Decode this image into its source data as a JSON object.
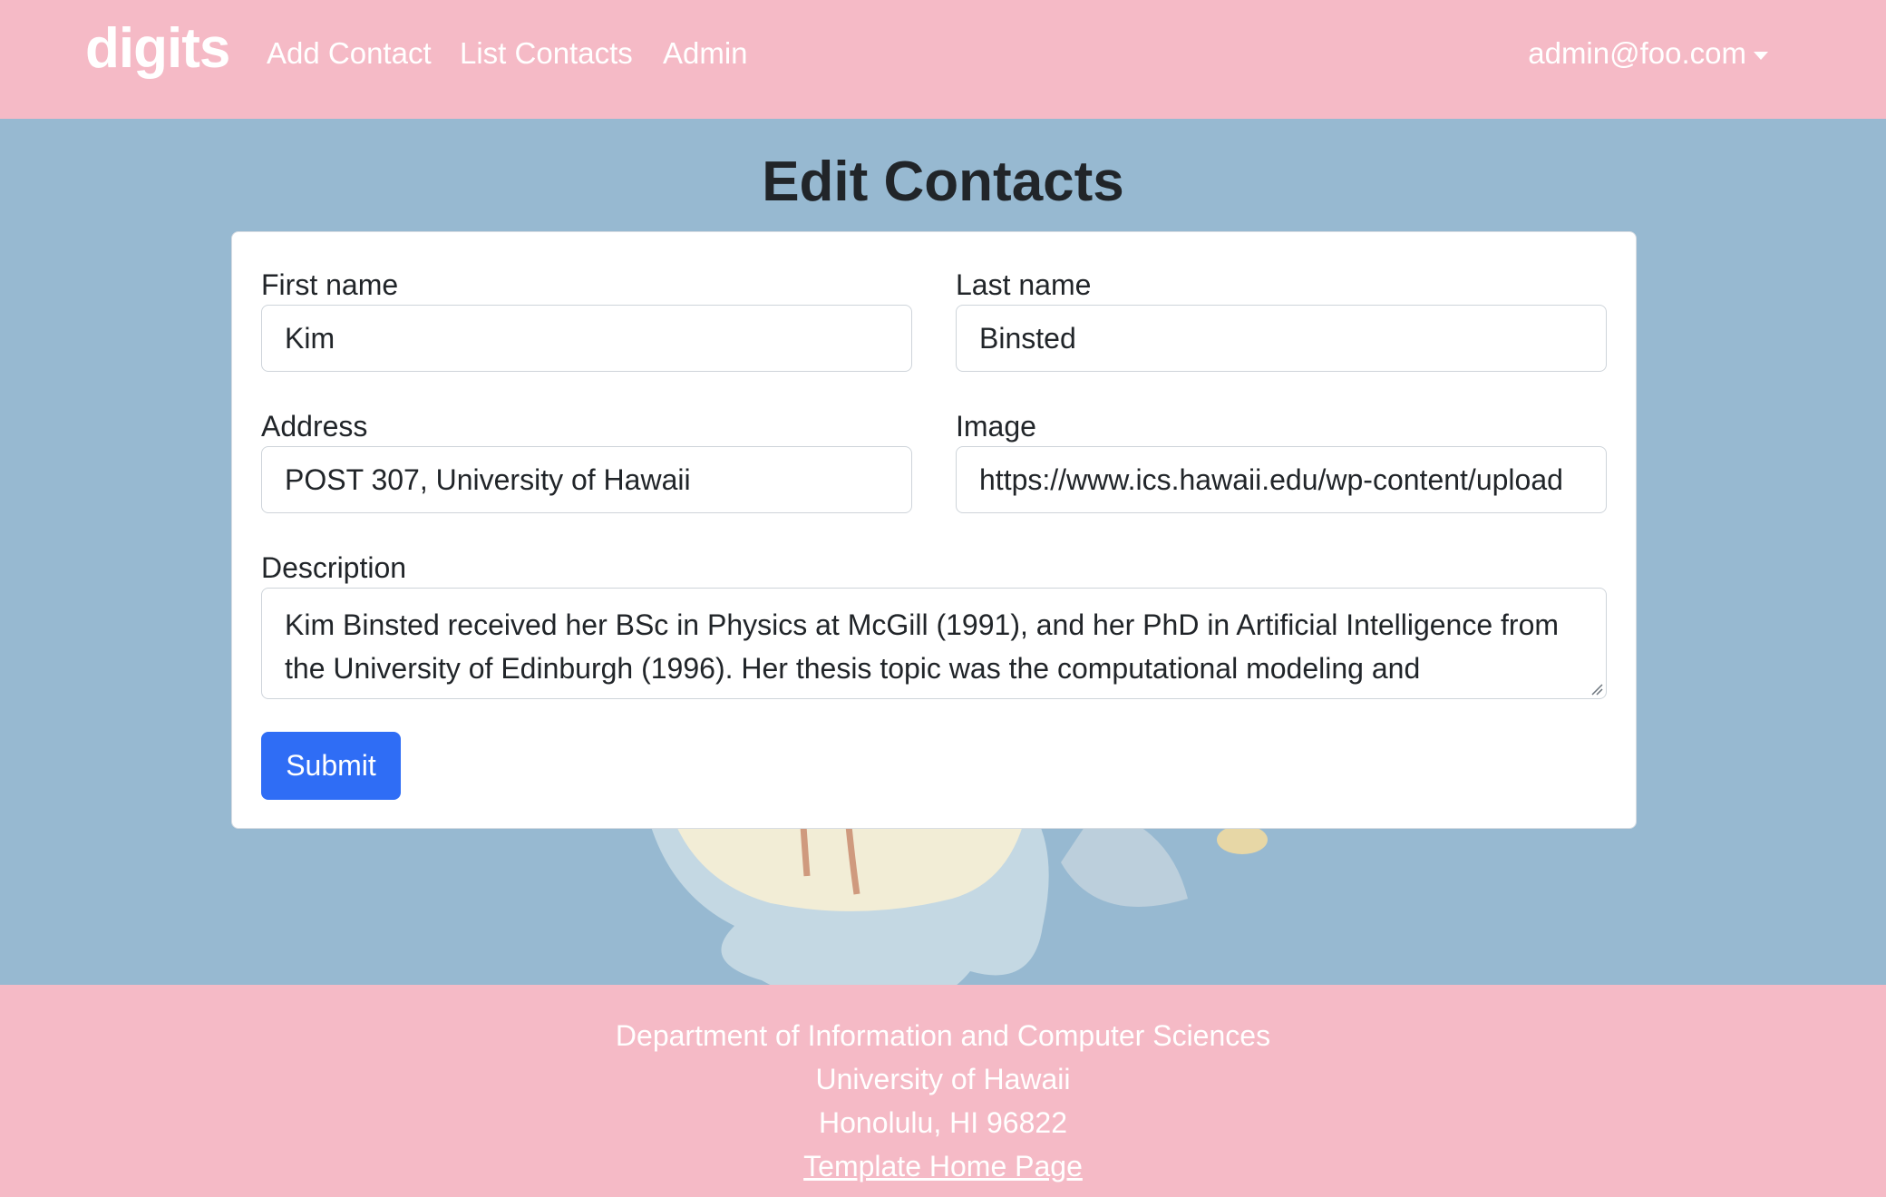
{
  "navbar": {
    "brand": "digits",
    "links": [
      "Add Contact",
      "List Contacts",
      "Admin"
    ],
    "user": "admin@foo.com"
  },
  "page": {
    "title": "Edit Contacts"
  },
  "form": {
    "first_name": {
      "label": "First name",
      "value": "Kim"
    },
    "last_name": {
      "label": "Last name",
      "value": "Binsted"
    },
    "address": {
      "label": "Address",
      "value": "POST 307, University of Hawaii"
    },
    "image": {
      "label": "Image",
      "value": "https://www.ics.hawaii.edu/wp-content/upload"
    },
    "description": {
      "label": "Description",
      "value": "Kim Binsted received her BSc in Physics at McGill (1991), and her PhD in Artificial Intelligence from the University of Edinburgh (1996). Her thesis topic was the computational modeling and"
    },
    "submit_label": "Submit"
  },
  "footer": {
    "line1": "Department of Information and Computer Sciences",
    "line2": "University of Hawaii",
    "line3": "Honolulu, HI 96822",
    "link": "Template Home Page"
  },
  "colors": {
    "navbar_bg": "#f5bac6",
    "page_bg": "#97b9d1",
    "primary_button": "#2f6df5"
  }
}
